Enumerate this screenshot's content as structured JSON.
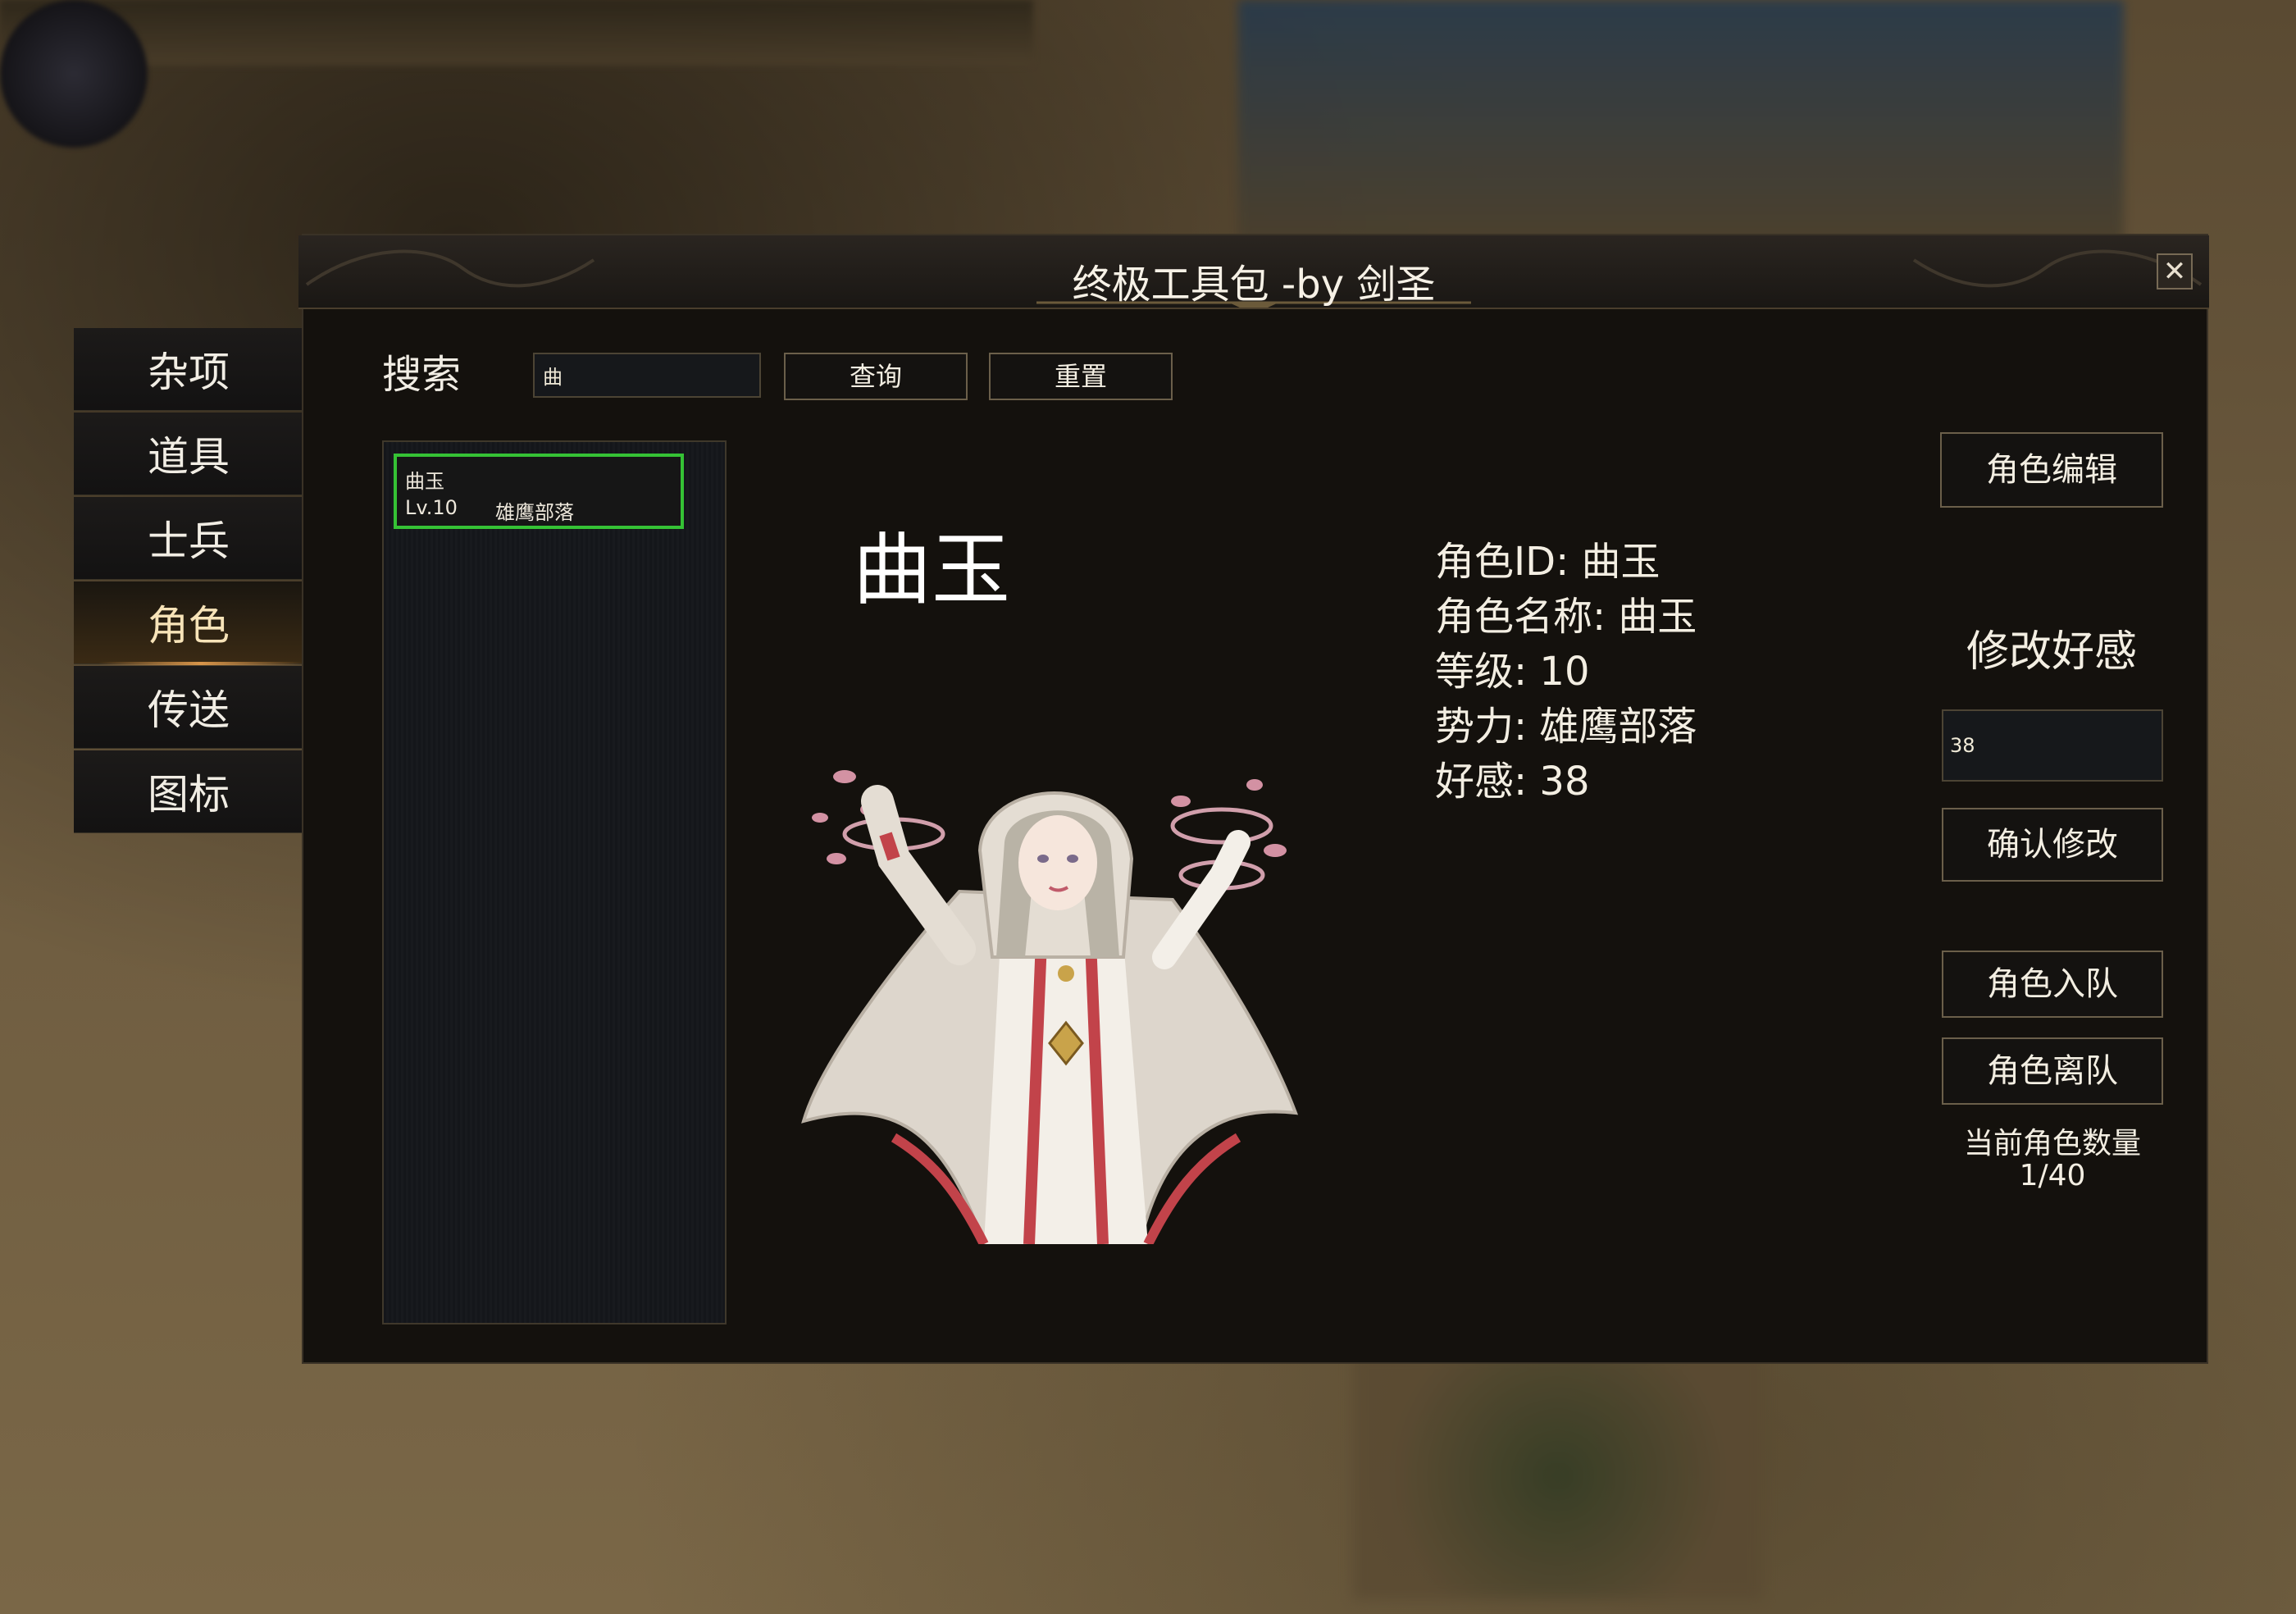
{
  "window": {
    "title": "终极工具包 -by 剑圣",
    "close_symbol": "✕"
  },
  "side_menu": {
    "items": [
      {
        "id": "misc",
        "label": "杂项"
      },
      {
        "id": "items",
        "label": "道具"
      },
      {
        "id": "soldiers",
        "label": "士兵"
      },
      {
        "id": "characters",
        "label": "角色",
        "active": true
      },
      {
        "id": "teleport",
        "label": "传送"
      },
      {
        "id": "icons",
        "label": "图标"
      }
    ]
  },
  "search": {
    "label": "搜索",
    "value": "曲",
    "query_button": "查询",
    "reset_button": "重置"
  },
  "results": [
    {
      "name": "曲玉",
      "level": "Lv.10",
      "faction": "雄鹰部落",
      "selected": true
    }
  ],
  "character": {
    "display_name": "曲玉",
    "id_line": "角色ID: 曲玉",
    "name_line": "角色名称: 曲玉",
    "level_line": "等级: 10",
    "faction_line": "势力: 雄鹰部落",
    "affection_line": "好感: 38"
  },
  "actions": {
    "edit_button": "角色编辑",
    "affection_label": "修改好感",
    "affection_value": "38",
    "confirm_button": "确认修改",
    "join_button": "角色入队",
    "leave_button": "角色离队",
    "count_label": "当前角色数量",
    "count_value": "1/40"
  },
  "colors": {
    "selected_border": "#35c235",
    "active_tab_accent": "#d8954a",
    "window_bg": "#14110d"
  }
}
